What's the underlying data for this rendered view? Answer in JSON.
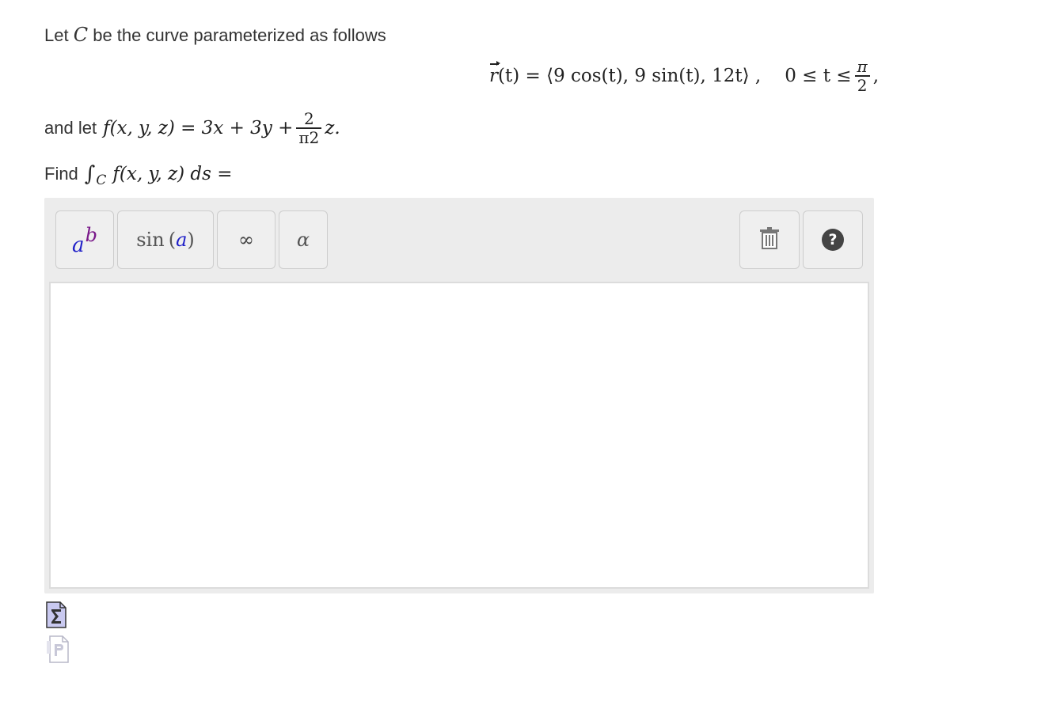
{
  "problem": {
    "intro_before": "Let",
    "curve_var": "C",
    "intro_after": "be the curve parameterized as follows",
    "param_equation": {
      "vector_name": "r",
      "lhs_rest": "(t) = ",
      "body": "⟨9 cos(t), 9 sin(t), 12t⟩ ,",
      "range_left": "0 ≤ t ≤",
      "range_num": "π",
      "range_den": "2",
      "trailing": ","
    },
    "function_intro": "and let",
    "function_expr": "f(x, y, z) = 3x + 3y +",
    "function_frac_num": "2",
    "function_frac_den": "π2",
    "function_tail": "z.",
    "find_label": "Find",
    "integral_sign": "∫",
    "integral_sub": "C",
    "integral_body": "f(x, y, z) ds ="
  },
  "toolbar": {
    "exponent_base": "a",
    "exponent_power": "b",
    "sin_fn": "sin",
    "sin_open": "(",
    "sin_arg": "a",
    "sin_close": ")",
    "infinity": "∞",
    "alpha": "α",
    "help": "?"
  },
  "answer": {
    "value": ""
  },
  "icons": {
    "trash": "trash-icon",
    "help": "help-icon",
    "sigma": "sigma-file-icon",
    "page": "page-file-icon"
  },
  "colors": {
    "exponent_base": "#2020c8",
    "exponent_power": "#7a1a8a",
    "panel_bg": "#ececec",
    "button_border": "#cdcdcd"
  }
}
